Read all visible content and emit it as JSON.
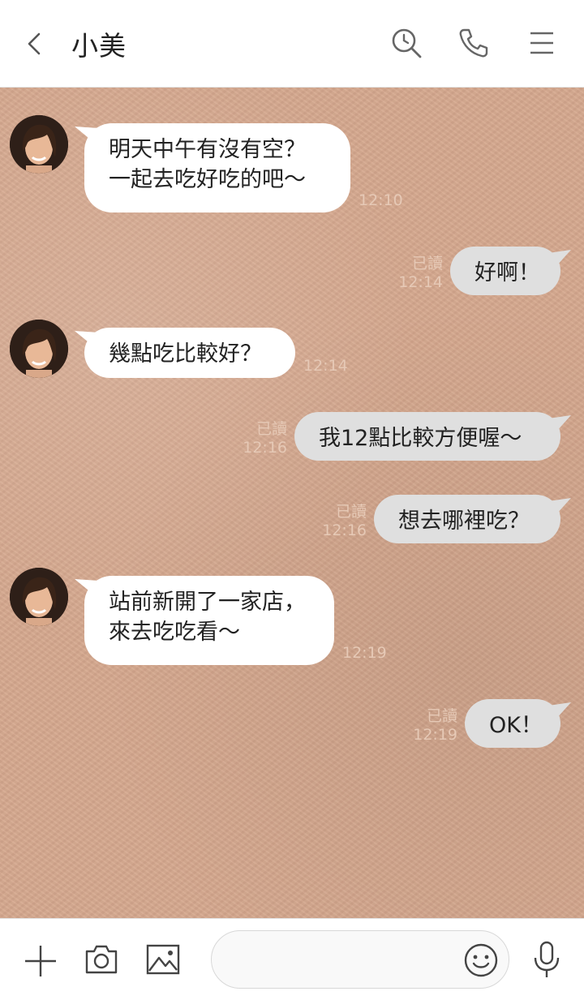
{
  "header": {
    "title": "小美",
    "icons": [
      "back-arrow-icon",
      "search-icon",
      "phone-icon",
      "menu-icon"
    ]
  },
  "contact": {
    "avatar_icon": "woman-portrait-avatar"
  },
  "messages": [
    {
      "direction": "in",
      "text": "明天中午有沒有空？\n一起去吃好吃的吧～",
      "time": "12:10"
    },
    {
      "direction": "out",
      "text": "好啊！",
      "time": "12:14",
      "read": "已讀"
    },
    {
      "direction": "in",
      "text": "幾點吃比較好？",
      "time": "12:14"
    },
    {
      "direction": "out",
      "text": "我12點比較方便喔～",
      "time": "12:16",
      "read": "已讀"
    },
    {
      "direction": "out",
      "text": "想去哪裡吃？",
      "time": "12:16",
      "read": "已讀"
    },
    {
      "direction": "in",
      "text": "站前新開了一家店，\n來去吃吃看～",
      "time": "12:19"
    },
    {
      "direction": "out",
      "text": "OK！",
      "time": "12:19",
      "read": "已讀"
    }
  ],
  "footer": {
    "input_value": "",
    "icons": [
      "plus-icon",
      "camera-icon",
      "image-icon",
      "emoji-icon",
      "microphone-icon"
    ]
  },
  "colors": {
    "chat_background": "#d6a88e",
    "incoming_bubble": "#ffffff",
    "outgoing_bubble": "#dfdfdf",
    "timestamp": "#e6c9b6"
  }
}
